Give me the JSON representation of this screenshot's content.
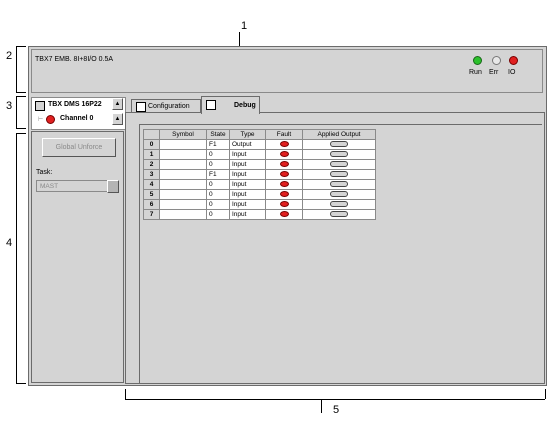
{
  "callouts": {
    "c1": "1",
    "c2": "2",
    "c3": "3",
    "c4": "4",
    "c5": "5"
  },
  "module_header": {
    "title": "TBX7 EMB. 8I+8I/O 0.5A",
    "leds": [
      {
        "label": "Run",
        "color": "#2cc12c"
      },
      {
        "label": "Err",
        "color": "#e8e8e8"
      },
      {
        "label": "IO",
        "color": "#e02020"
      }
    ]
  },
  "channel_selector": {
    "module": "TBX DMS 16P22",
    "channel": "Channel 0"
  },
  "left_panel": {
    "global_unforce": "Global Unforce",
    "task_label": "Task:",
    "task_value": "MAST"
  },
  "tabs": {
    "configuration": "Configuration",
    "debug": "Debug"
  },
  "debug_table": {
    "headers": [
      "Symbol",
      "State",
      "Type",
      "Fault",
      "Applied Output"
    ],
    "rows": [
      {
        "num": "0",
        "symbol": "",
        "state": "F1",
        "type": "Output"
      },
      {
        "num": "1",
        "symbol": "",
        "state": "0",
        "type": "Input"
      },
      {
        "num": "2",
        "symbol": "",
        "state": "0",
        "type": "Input"
      },
      {
        "num": "3",
        "symbol": "",
        "state": "F1",
        "type": "Input"
      },
      {
        "num": "4",
        "symbol": "",
        "state": "0",
        "type": "Input"
      },
      {
        "num": "5",
        "symbol": "",
        "state": "0",
        "type": "Input"
      },
      {
        "num": "6",
        "symbol": "",
        "state": "0",
        "type": "Input"
      },
      {
        "num": "7",
        "symbol": "",
        "state": "0",
        "type": "Input"
      }
    ]
  }
}
